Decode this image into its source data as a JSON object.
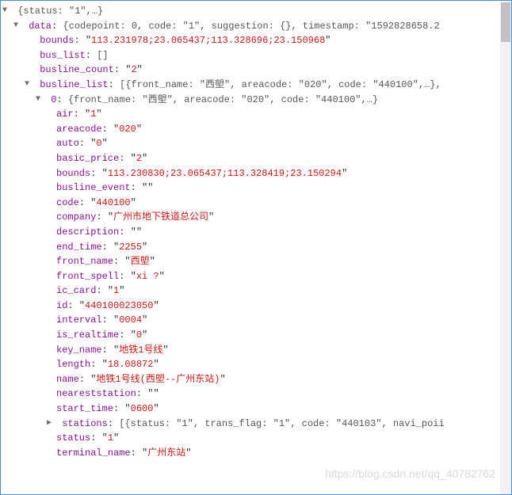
{
  "root": {
    "summary": "{status: \"1\",…}"
  },
  "data_node": {
    "summary": "{codepoint: 0, code: \"1\", suggestion: {}, timestamp: \"1592828658.2",
    "bounds": "113.231978;23.065437;113.328696;23.150968",
    "bus_list": "[]",
    "busline_count": "2"
  },
  "busline_list": {
    "summary": "[{front_name: \"西塱\", areacode: \"020\", code: \"440100\",…},"
  },
  "item0": {
    "summary": "{front_name: \"西塱\", areacode: \"020\", code: \"440100\",…}",
    "air": "1",
    "areacode": "020",
    "auto": "0",
    "basic_price": "2",
    "bounds": "113.230830;23.065437;113.328419;23.150294",
    "busline_event": "",
    "code": "440100",
    "company": "广州市地下铁道总公司",
    "description": "",
    "end_time": "2255",
    "front_name": "西塱",
    "front_spell": "xi ?",
    "ic_card": "1",
    "id": "440100023050",
    "interval": "0004",
    "is_realtime": "0",
    "key_name": "地铁1号线",
    "length": "18.08872",
    "name": "地铁1号线(西塱--广州东站)",
    "neareststation": "",
    "start_time": "0600",
    "status": "1",
    "terminal_name": "广州东站"
  },
  "stations": {
    "summary": "[{status: \"1\", trans_flag: \"1\", code: \"440103\", navi_poii"
  },
  "labels": {
    "data": "data",
    "bounds": "bounds",
    "bus_list": "bus_list",
    "busline_count": "busline_count",
    "busline_list": "busline_list",
    "zero": "0",
    "air": "air",
    "areacode": "areacode",
    "auto": "auto",
    "basic_price": "basic_price",
    "busline_event": "busline_event",
    "code": "code",
    "company": "company",
    "description": "description",
    "end_time": "end_time",
    "front_name": "front_name",
    "front_spell": "front_spell",
    "ic_card": "ic_card",
    "id": "id",
    "interval": "interval",
    "is_realtime": "is_realtime",
    "key_name": "key_name",
    "length": "length",
    "name": "name",
    "neareststation": "neareststation",
    "start_time": "start_time",
    "stations": "stations",
    "status": "status",
    "terminal_name": "terminal_name"
  },
  "watermark": "https://blog.csdn.net/qq_40782762"
}
